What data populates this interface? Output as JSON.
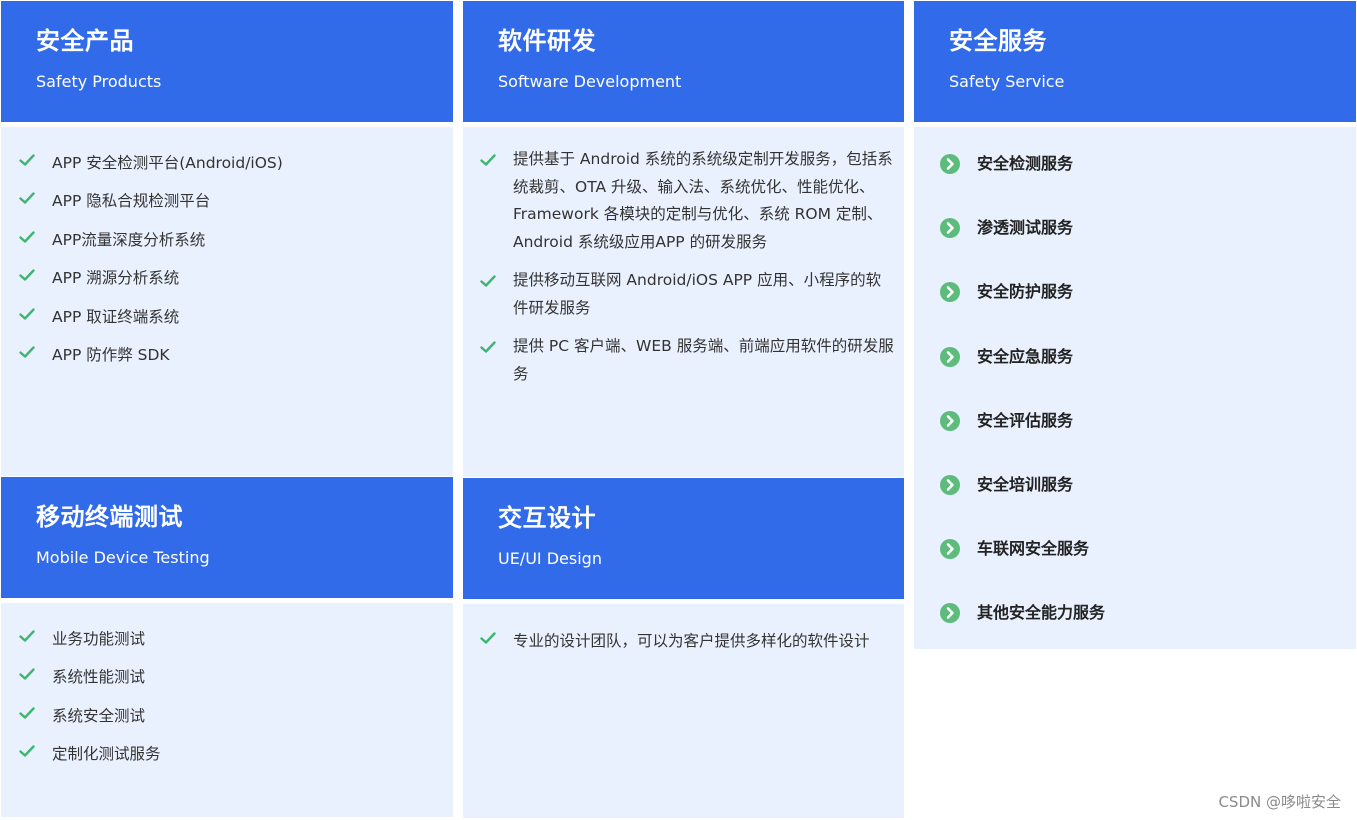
{
  "colors": {
    "header_bg": "#316be9",
    "body_bg": "#eaf1fe",
    "check": "#3fb56f",
    "service_icon": "#5dbb7c"
  },
  "icons": {
    "list_bullet": "check-icon",
    "service_bullet": "chevron-circle-icon"
  },
  "cards": {
    "safety_products": {
      "title": "安全产品",
      "subtitle": "Safety Products",
      "items": [
        "APP 安全检测平台(Android/iOS)",
        "APP 隐私合规检测平台",
        "APP流量深度分析系统",
        "APP 溯源分析系统",
        "APP 取证终端系统",
        "APP 防作弊 SDK"
      ]
    },
    "software_development": {
      "title": "软件研发",
      "subtitle": "Software Development",
      "items": [
        "提供基于 Android 系统的系统级定制开发服务，包括系统裁剪、OTA 升级、输入法、系统优化、性能优化、Framework 各模块的定制与优化、系统 ROM 定制、Android 系统级应用APP 的研发服务",
        "提供移动互联网 Android/iOS APP 应用、小程序的软件研发服务",
        "提供 PC 客户端、WEB 服务端、前端应用软件的研发服务"
      ]
    },
    "safety_service": {
      "title": "安全服务",
      "subtitle": "Safety Service",
      "items": [
        "安全检测服务",
        "渗透测试服务",
        "安全防护服务",
        "安全应急服务",
        "安全评估服务",
        "安全培训服务",
        "车联网安全服务",
        "其他安全能力服务"
      ]
    },
    "mobile_testing": {
      "title": "移动终端测试",
      "subtitle": "Mobile Device Testing",
      "items": [
        "业务功能测试",
        "系统性能测试",
        "系统安全测试",
        "定制化测试服务"
      ]
    },
    "ui_design": {
      "title": "交互设计",
      "subtitle": "UE/UI Design",
      "items": [
        "专业的设计团队，可以为客户提供多样化的软件设计"
      ]
    }
  },
  "watermark": "CSDN @哆啦安全"
}
